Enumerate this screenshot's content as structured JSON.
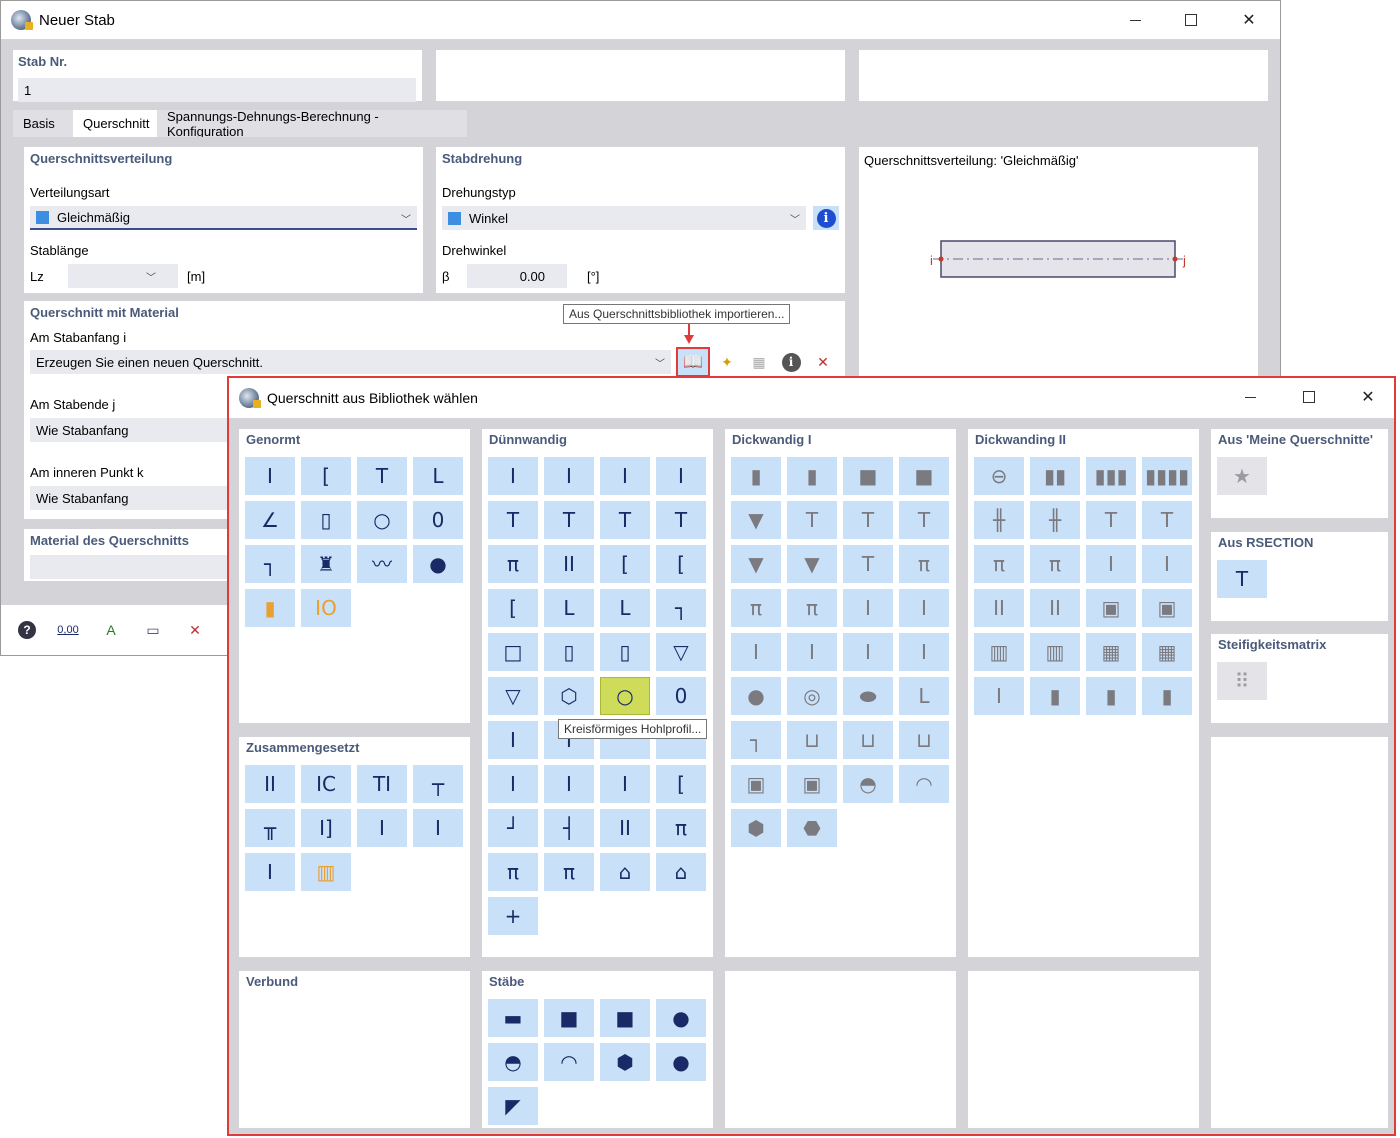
{
  "main_window": {
    "title": "Neuer Stab",
    "stab_nr_label": "Stab Nr.",
    "stab_nr_value": "1",
    "tabs": [
      {
        "label": "Basis"
      },
      {
        "label": "Querschnitt"
      },
      {
        "label": "Spannungs-Dehnungs-Berechnung - Konfiguration"
      }
    ],
    "distribution": {
      "header": "Querschnittsverteilung",
      "type_label": "Verteilungsart",
      "type_value": "Gleichmäßig",
      "length_label": "Stablänge",
      "lz_symbol": "Lz",
      "unit": "[m]"
    },
    "rotation": {
      "header": "Stabdrehung",
      "type_label": "Drehungstyp",
      "type_value": "Winkel",
      "angle_label": "Drehwinkel",
      "beta_symbol": "β",
      "beta_value": "0.00",
      "unit": "[°]"
    },
    "preview": {
      "title": "Querschnittsverteilung: 'Gleichmäßig'",
      "node_i": "i",
      "node_j": "j"
    },
    "section": {
      "header": "Querschnitt mit Material",
      "start_label": "Am Stabanfang i",
      "start_value": "Erzeugen Sie einen neuen Querschnitt.",
      "end_label": "Am Stabende j",
      "end_value": "Wie Stabanfang",
      "inner_label": "Am inneren Punkt k",
      "inner_value": "Wie Stabanfang",
      "material_header": "Material des Querschnitts"
    },
    "tooltip_import": "Aus Querschnittsbibliothek importieren...",
    "bottom_value": "0,00"
  },
  "dialog": {
    "title": "Querschnitt aus Bibliothek wählen",
    "tooltip_selected": "Kreisförmiges Hohlprofil...",
    "columns": {
      "genormt": {
        "header": "Genormt",
        "cells": [
          "I",
          "[",
          "T",
          "L",
          "∠",
          "▯",
          "○",
          "0",
          "┐",
          "♜",
          "〰",
          "●",
          "▮",
          "IO"
        ]
      },
      "zusammengesetzt": {
        "header": "Zusammengesetzt",
        "cells": [
          "II",
          "IC",
          "TI",
          "┬",
          "╥",
          "I]",
          "I",
          "I",
          "I",
          "▥"
        ]
      },
      "verbund": {
        "header": "Verbund"
      },
      "duennwandig": {
        "header": "Dünnwandig",
        "cells": [
          "I",
          "I",
          "I",
          "I",
          "T",
          "T",
          "T",
          "T",
          "π",
          "II",
          "[",
          "[",
          "[",
          "L",
          "L",
          "┐",
          "□",
          "▯",
          "▯",
          "▽",
          "▽",
          "⬡",
          "○",
          "0",
          "I",
          "I",
          "",
          "",
          "I",
          "I",
          "I",
          "[",
          "┘",
          "┤",
          "II",
          "π",
          "π",
          "π",
          "⌂",
          "⌂",
          "+"
        ]
      },
      "staebe": {
        "header": "Stäbe",
        "cells": [
          "▬",
          "■",
          "■",
          "●",
          "◓",
          "◠",
          "⬢",
          "●",
          "◤"
        ]
      },
      "dickwandig1": {
        "header": "Dickwandig I",
        "cells": [
          "▮",
          "▮",
          "■",
          "■",
          "▼",
          "T",
          "T",
          "T",
          "▼",
          "▼",
          "T",
          "π",
          "π",
          "π",
          "I",
          "I",
          "I",
          "I",
          "I",
          "I",
          "●",
          "◎",
          "⬬",
          "L",
          "┐",
          "⊔",
          "⊔",
          "⊔",
          "▣",
          "▣",
          "◓",
          "◠",
          "⬢",
          "⬣"
        ]
      },
      "dickwandig2": {
        "header": "Dickwanding II",
        "cells": [
          "⊖",
          "▮▮",
          "▮▮▮",
          "▮▮▮▮",
          "╫",
          "╫",
          "T",
          "T",
          "π",
          "π",
          "I",
          "I",
          "II",
          "II",
          "▣",
          "▣",
          "▥",
          "▥",
          "▦",
          "▦",
          "I",
          "▮",
          "▮",
          "▮"
        ]
      },
      "meine": {
        "header": "Aus 'Meine Querschnitte'",
        "cells": [
          "★"
        ]
      },
      "rsection": {
        "header": "Aus RSECTION",
        "cells": [
          "T"
        ]
      },
      "steifigkeit": {
        "header": "Steifigkeitsmatrix",
        "cells": [
          "⠿"
        ]
      }
    }
  }
}
